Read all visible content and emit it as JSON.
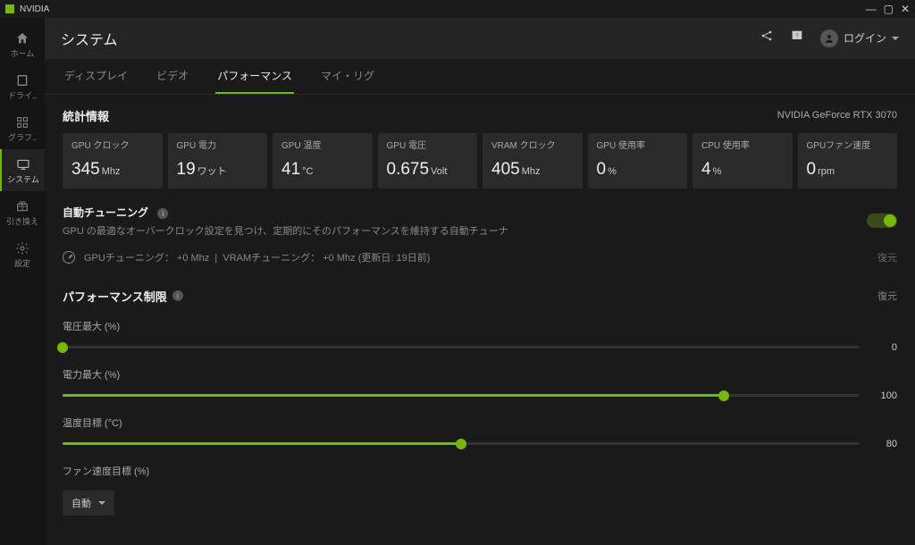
{
  "titlebar": {
    "title": "NVIDIA"
  },
  "sidebar": {
    "items": [
      {
        "label": "ホーム"
      },
      {
        "label": "ドライ.."
      },
      {
        "label": "グラフ.."
      },
      {
        "label": "システム"
      },
      {
        "label": "引き換え"
      },
      {
        "label": "設定"
      }
    ]
  },
  "header": {
    "title": "システム",
    "login": "ログイン"
  },
  "tabs": [
    {
      "label": "ディスプレイ"
    },
    {
      "label": "ビデオ"
    },
    {
      "label": "パフォーマンス"
    },
    {
      "label": "マイ・リグ"
    }
  ],
  "stats": {
    "heading": "統計情報",
    "gpu_name": "NVIDIA GeForce RTX 3070",
    "cards": [
      {
        "label": "GPU クロック",
        "value": "345",
        "unit": "Mhz"
      },
      {
        "label": "GPU 電力",
        "value": "19",
        "unit": "ワット"
      },
      {
        "label": "GPU 温度",
        "value": "41",
        "unit": "°C"
      },
      {
        "label": "GPU 電圧",
        "value": "0.675",
        "unit": "Volt"
      },
      {
        "label": "VRAM クロック",
        "value": "405",
        "unit": "Mhz"
      },
      {
        "label": "GPU 使用率",
        "value": "0",
        "unit": "%"
      },
      {
        "label": "CPU 使用率",
        "value": "4",
        "unit": "%"
      },
      {
        "label": "GPUファン速度",
        "value": "0",
        "unit": "rpm"
      }
    ]
  },
  "auto_tune": {
    "title": "自動チューニング",
    "description": "GPU の最適なオーバークロック設定を見つけ、定期的にそのパフォーマンスを維持する自動チューナ",
    "gpu_tune_label": "GPUチューニング：",
    "gpu_tune_value": "+0 Mhz",
    "vram_tune_label": "VRAMチューニング：",
    "vram_tune_value": "+0 Mhz",
    "updated_label": "(更新日: 19日前)",
    "restore": "復元"
  },
  "perf_limit": {
    "title": "パフォーマンス制限",
    "restore": "復元",
    "sliders": [
      {
        "label": "電圧最大 (%)",
        "value": "0",
        "percent": 0
      },
      {
        "label": "電力最大 (%)",
        "value": "100",
        "percent": 83
      },
      {
        "label": "温度目標 (°C)",
        "value": "80",
        "percent": 50
      }
    ],
    "fan_label": "ファン速度目標 (%)",
    "fan_selected": "自動"
  }
}
